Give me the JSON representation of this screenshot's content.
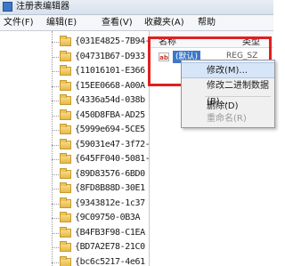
{
  "window": {
    "title": "注册表编辑器"
  },
  "menu": [
    "文件(F)",
    "编辑(E)",
    "查看(V)",
    "收藏夹(A)",
    "帮助"
  ],
  "tree": {
    "items": [
      "{031E4825-7B94-",
      "{04731B67-D933",
      "{11016101-E366",
      "{15EE0668-A00A",
      "{4336a54d-038b",
      "{450D8FBA-AD25",
      "{5999e694-5CE5",
      "{59031e47-3f72-",
      "{645FF040-5081-",
      "{89D83576-6BD0",
      "{8FD8B88D-30E1",
      "{9343812e-1c37",
      "{9C09750-0B3A",
      "{B4FB3F98-C1EA",
      "{BD7A2E78-21C0",
      "{bc6c5217-4e61"
    ]
  },
  "right_pane": {
    "col_name": "名称",
    "col_type": "类型",
    "value": {
      "icon": "ab",
      "name": "(默认)",
      "type": "REG_SZ"
    }
  },
  "context_menu": {
    "items": [
      {
        "label": "修改(M)...",
        "state": "active"
      },
      {
        "label": "修改二进制数据(B)...",
        "state": "normal"
      },
      {
        "label": "删除(D)",
        "state": "normal"
      },
      {
        "label": "重命名(R)",
        "state": "disabled"
      }
    ]
  },
  "colors": {
    "highlight_border": "#e02020",
    "selection": "#3d78c9"
  }
}
